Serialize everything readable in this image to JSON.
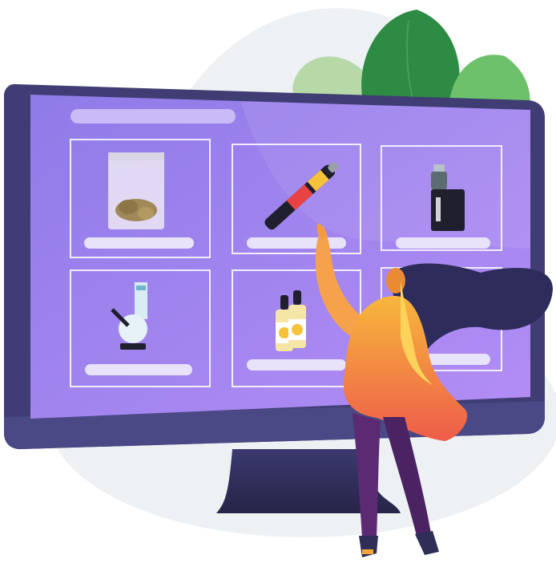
{
  "scene": {
    "type": "illustration",
    "subject": "woman-browsing-product-grid-on-monitor"
  },
  "colors": {
    "background": "#ffffff",
    "backdrop_blob": "#eef1f4",
    "monitor_frame": "#3f3d73",
    "monitor_stand": "#2f2e57",
    "screen": "#a78bf0",
    "card_stroke": "#ffffff",
    "label_bar": "#e8e2fb",
    "leaf_dark": "#2e8b43",
    "leaf_mid": "#6cc16a",
    "leaf_light": "#b7d9a8",
    "hair": "#2d2c5a",
    "skin": "#f6a24b",
    "top": "#f6a93a",
    "pants": "#5b2a72"
  },
  "products": [
    {
      "icon": "bag-icon"
    },
    {
      "icon": "vape-pen-icon"
    },
    {
      "icon": "vape-mod-icon"
    },
    {
      "icon": "bong-icon"
    },
    {
      "icon": "dropper-bottles-icon"
    },
    {
      "icon": "empty-card"
    }
  ]
}
